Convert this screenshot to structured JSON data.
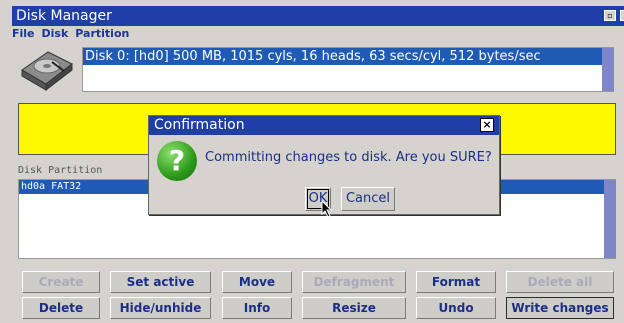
{
  "window": {
    "title": "Disk Manager"
  },
  "menu": [
    "File",
    "Disk",
    "Partition"
  ],
  "disk": {
    "selected_row": "Disk 0: [hd0] 500 MB, 1015 cyls, 16 heads, 63 secs/cyl, 512 bytes/sec"
  },
  "partitions": {
    "label": "Disk Partition",
    "rows": [
      "hd0a FAT32"
    ]
  },
  "buttons_row1": [
    "Create",
    "Set active",
    "Move",
    "Defragment",
    "Format",
    "Delete all"
  ],
  "buttons_row2": [
    "Delete",
    "Hide/unhide",
    "Info",
    "Resize",
    "Undo",
    "Write changes"
  ],
  "dialog": {
    "title": "Confirmation",
    "message": "Committing changes to disk.  Are you SURE?",
    "ok": "OK",
    "cancel": "Cancel",
    "close_glyph": "×",
    "icon_glyph": "?"
  },
  "colors": {
    "titlebar": "#1f3fa6",
    "selection": "#1f5bb5",
    "partition_map": "#fefb01",
    "question_icon": "#2c9a1a"
  },
  "icons": [
    "hard-disk-icon",
    "question-icon",
    "close-icon",
    "mouse-cursor-icon"
  ]
}
